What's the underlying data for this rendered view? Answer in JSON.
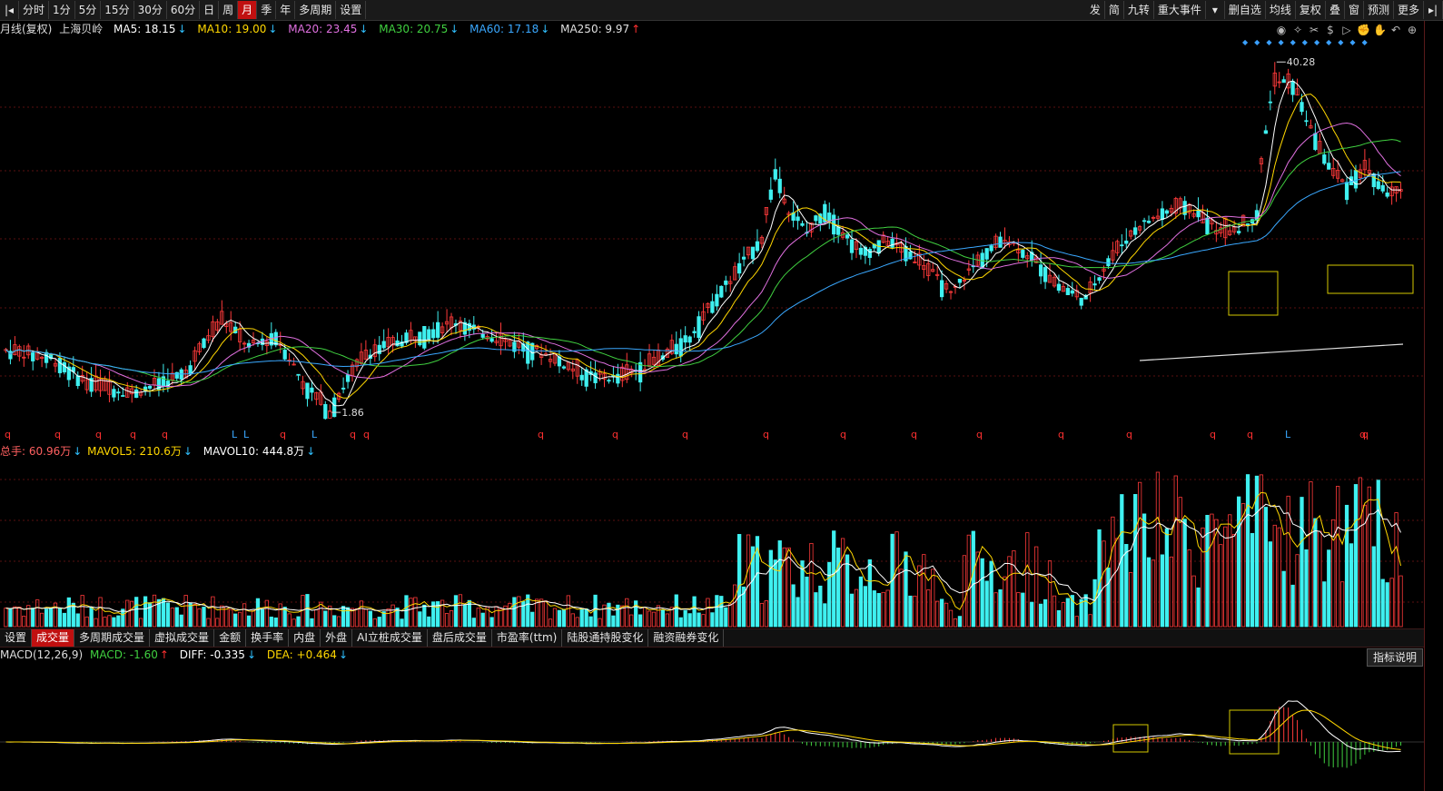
{
  "toolbar": {
    "left": [
      "分时",
      "1分",
      "5分",
      "15分",
      "30分",
      "60分",
      "日",
      "周",
      "月",
      "季",
      "年",
      "多周期",
      "设置"
    ],
    "active_index": 8,
    "right": [
      "发",
      "简",
      "九转",
      "重大事件",
      "删自选",
      "均线",
      "复权",
      "叠",
      "窗",
      "预测",
      "更多"
    ]
  },
  "main_info": {
    "period": "月线(复权)",
    "name": "上海贝岭",
    "ma5": "MA5: 18.15",
    "ma10": "MA10: 19.00",
    "ma20": "MA20: 23.45",
    "ma30": "MA30: 20.75",
    "ma60": "MA60: 17.18",
    "ma250": "MA250: 9.97"
  },
  "chart_data": [
    {
      "type": "candlestick",
      "title": "上海贝岭 月线",
      "annotations": {
        "high": "40.28",
        "low": "1.86"
      },
      "marker_labels": [
        "q",
        "q",
        "q",
        "q",
        "q",
        "L",
        "L",
        "q",
        "L",
        "q",
        "q",
        "q",
        "q",
        "q",
        "q",
        "q",
        "q",
        "q",
        "q",
        "q",
        "q",
        "q",
        "L",
        "q",
        "q"
      ]
    },
    {
      "type": "bar",
      "title": "成交量",
      "labels": {
        "vol": "总手: 60.96万",
        "mavol5": "MAVOL5: 210.6万",
        "mavol10": "MAVOL10: 444.8万"
      }
    },
    {
      "type": "bar",
      "title": "MACD(12,26,9)",
      "labels": {
        "macd": "MACD: -1.60",
        "diff": "DIFF: -0.335",
        "dea": "DEA: +0.464"
      }
    }
  ],
  "tabs": [
    "设置",
    "成交量",
    "多周期成交量",
    "虚拟成交量",
    "金额",
    "换手率",
    "内盘",
    "外盘",
    "AI立桩成交量",
    "盘后成交量",
    "市盈率(ttm)",
    "陆股通持股变化",
    "融资融券变化"
  ],
  "active_tab": 1,
  "help_button": "指标说明",
  "colors": {
    "up": "#ff3a3a",
    "down": "#3ff0f0",
    "ma5": "#ffffff",
    "ma10": "#ffd700",
    "ma20": "#e070e0",
    "ma30": "#40d040",
    "ma60": "#3aa8ff",
    "ma250": "#e0e0e0",
    "grid": "#5a1010"
  }
}
